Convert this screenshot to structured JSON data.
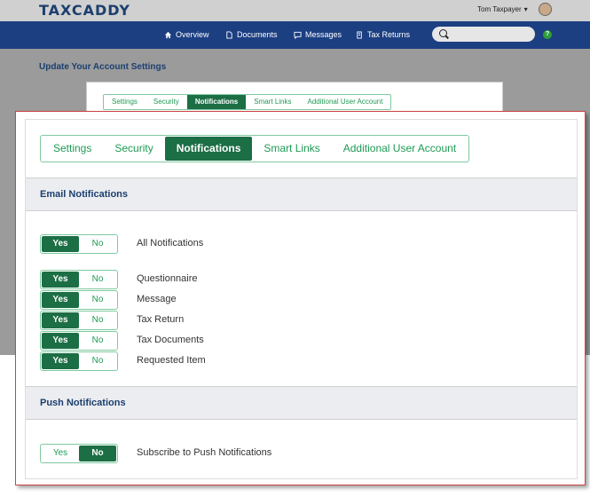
{
  "app": {
    "logo": "TAXCADDY"
  },
  "user": {
    "name": "Tom Taxpayer",
    "caret": "▾"
  },
  "nav": {
    "items": [
      {
        "label": "Overview",
        "icon": "home-icon"
      },
      {
        "label": "Documents",
        "icon": "document-icon"
      },
      {
        "label": "Messages",
        "icon": "message-icon"
      },
      {
        "label": "Tax Returns",
        "icon": "tax-return-icon"
      }
    ],
    "help": "?"
  },
  "page": {
    "title": "Update Your Account Settings"
  },
  "tabs": [
    {
      "label": "Settings",
      "active": false
    },
    {
      "label": "Security",
      "active": false
    },
    {
      "label": "Notifications",
      "active": true
    },
    {
      "label": "Smart Links",
      "active": false
    },
    {
      "label": "Additional User Account",
      "active": false
    }
  ],
  "email": {
    "title": "Email Notifications",
    "all": {
      "label": "All Notifications",
      "value": "Yes"
    },
    "items": [
      {
        "label": "Questionnaire",
        "value": "Yes"
      },
      {
        "label": "Message",
        "value": "Yes"
      },
      {
        "label": "Tax Return",
        "value": "Yes"
      },
      {
        "label": "Tax Documents",
        "value": "Yes"
      },
      {
        "label": "Requested Item",
        "value": "Yes"
      }
    ]
  },
  "push": {
    "title": "Push Notifications",
    "items": [
      {
        "label": "Subscribe to Push Notifications",
        "value": "No"
      }
    ]
  },
  "toggle": {
    "yes": "Yes",
    "no": "No"
  },
  "colors": {
    "brand_dark": "#1c3f82",
    "accent_green": "#1c6e45",
    "green_text": "#1f9a55"
  }
}
